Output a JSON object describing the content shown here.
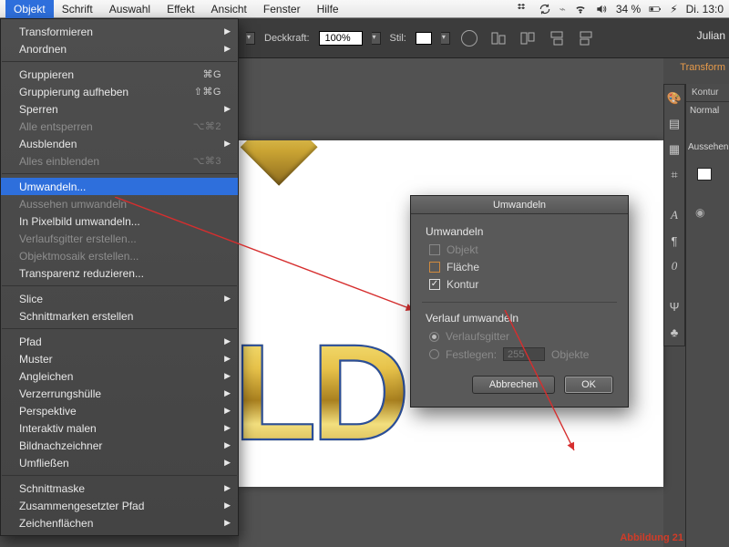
{
  "menubar": {
    "items": [
      "Objekt",
      "Schrift",
      "Auswahl",
      "Effekt",
      "Ansicht",
      "Fenster",
      "Hilfe"
    ],
    "active_index": 0,
    "status": {
      "battery": "34 %",
      "charging_glyph": "⚡︎",
      "clock": "Di. 13:0"
    }
  },
  "userbar": {
    "name": "Julian"
  },
  "options_bar": {
    "opacity_label": "Deckkraft:",
    "opacity_value": "100%",
    "style_label": "Stil:",
    "transform_label": "Transform"
  },
  "dropdown": {
    "sections": [
      [
        {
          "label": "Transformieren",
          "submenu": true
        },
        {
          "label": "Anordnen",
          "submenu": true
        }
      ],
      [
        {
          "label": "Gruppieren",
          "shortcut": "⌘G"
        },
        {
          "label": "Gruppierung aufheben",
          "shortcut": "⇧⌘G"
        },
        {
          "label": "Sperren",
          "submenu": true
        },
        {
          "label": "Alle entsperren",
          "shortcut": "⌥⌘2",
          "disabled": true
        },
        {
          "label": "Ausblenden",
          "submenu": true
        },
        {
          "label": "Alles einblenden",
          "shortcut": "⌥⌘3",
          "disabled": true
        }
      ],
      [
        {
          "label": "Umwandeln...",
          "selected": true
        },
        {
          "label": "Aussehen umwandeln",
          "disabled": true
        },
        {
          "label": "In Pixelbild umwandeln..."
        },
        {
          "label": "Verlaufsgitter erstellen...",
          "disabled": true
        },
        {
          "label": "Objektmosaik erstellen...",
          "disabled": true
        },
        {
          "label": "Transparenz reduzieren..."
        }
      ],
      [
        {
          "label": "Slice",
          "submenu": true
        },
        {
          "label": "Schnittmarken erstellen"
        }
      ],
      [
        {
          "label": "Pfad",
          "submenu": true
        },
        {
          "label": "Muster",
          "submenu": true
        },
        {
          "label": "Angleichen",
          "submenu": true
        },
        {
          "label": "Verzerrungshülle",
          "submenu": true
        },
        {
          "label": "Perspektive",
          "submenu": true
        },
        {
          "label": "Interaktiv malen",
          "submenu": true
        },
        {
          "label": "Bildnachzeichner",
          "submenu": true
        },
        {
          "label": "Umfließen",
          "submenu": true
        }
      ],
      [
        {
          "label": "Schnittmaske",
          "submenu": true
        },
        {
          "label": "Zusammengesetzter Pfad",
          "submenu": true
        },
        {
          "label": "Zeichenflächen",
          "submenu": true
        }
      ]
    ]
  },
  "dialog": {
    "title": "Umwandeln",
    "group1_title": "Umwandeln",
    "opts": {
      "object_label": "Objekt",
      "object_checked": false,
      "object_disabled": true,
      "fill_label": "Fläche",
      "fill_checked": false,
      "stroke_label": "Kontur",
      "stroke_checked": true
    },
    "group2_title": "Verlauf umwandeln",
    "gradient": {
      "mesh_label": "Verlaufsgitter",
      "mesh_selected": true,
      "specify_label": "Festlegen:",
      "specify_value": "255",
      "specify_unit": "Objekte"
    },
    "buttons": {
      "cancel": "Abbrechen",
      "ok": "OK"
    }
  },
  "panels": {
    "kontur_tab": "Kontur",
    "normal_label": "Normal",
    "aussehen_tab": "Aussehen"
  },
  "right_rail_icons": [
    "palette",
    "layers",
    "artboard",
    "crop",
    "type-A",
    "pilcrow",
    "zero",
    "usb",
    "club"
  ],
  "artwork": {
    "gold_text": "LD"
  },
  "footer_annotation": "Abbildung  21"
}
